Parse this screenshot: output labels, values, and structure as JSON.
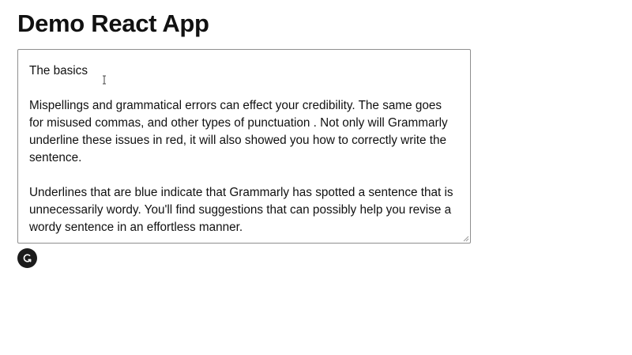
{
  "app": {
    "title": "Demo React App"
  },
  "editor": {
    "heading": "The basics",
    "paragraph_1": "Mispellings and grammatical errors can effect your credibility. The same goes for misused commas, and other types of punctuation . Not only will Grammarly underline these issues in red, it will also showed you how to correctly write the sentence.",
    "paragraph_2": "Underlines that are blue indicate that Grammarly has spotted a sentence that is unnecessarily wordy. You'll find suggestions that can possibly help you revise a wordy sentence in an effortless manner."
  },
  "grammarly_button": {
    "icon": "grammarly-icon",
    "color": "#1b1b1b"
  }
}
